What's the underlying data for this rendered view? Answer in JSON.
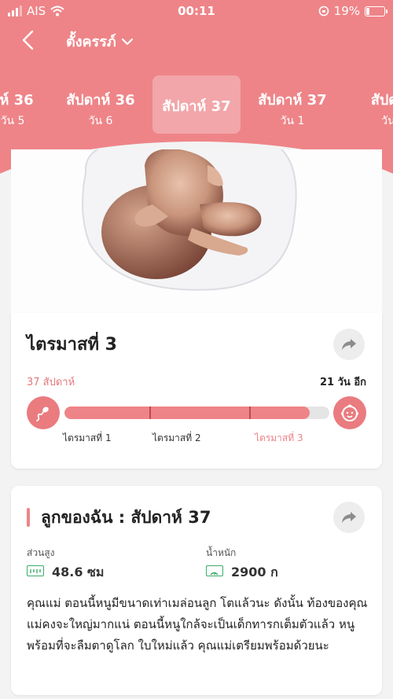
{
  "status_bar": {
    "carrier": "AIS",
    "time": "00:11",
    "battery": "19%",
    "battery_level": 0.19
  },
  "nav": {
    "title": "ตั้งครรภ์"
  },
  "tabs": [
    {
      "line1": "าห์ 36",
      "line2": "วัน 5"
    },
    {
      "line1": "สัปดาห์ 36",
      "line2": "วัน 6"
    },
    {
      "line1": "สัปดาห์ 37",
      "line2": ""
    },
    {
      "line1": "สัปดาห์ 37",
      "line2": "วัน 1"
    },
    {
      "line1": "สัปดา",
      "line2": "วัน"
    }
  ],
  "trimester": {
    "title": "ไตรมาสที่ 3",
    "weeks": "37 สัปดาห์",
    "days_left": "21 วัน อีก",
    "progress": 0.925,
    "labels": [
      "ไตรมาสที่ 1",
      "ไตรมาสที่ 2",
      "ไตรมาสที่ 3"
    ]
  },
  "baby": {
    "title": "ลูกของฉัน :  สัปดาห์ 37",
    "height_label": "ส่วนสูง",
    "height_value": "48.6 ซม",
    "weight_label": "น้ำหนัก",
    "weight_value": "2900 ก",
    "description": "คุณแม่ ตอนนี้หนูมีขนาดเท่าเมล่อนลูก โตแล้วนะ ดังนั้น ท้องของคุณแม่คงจะใหญ่มากแน่ ตอนนี้หนูใกล้จะเป็นเด็กทารกเต็มตัวแล้ว หนูพร้อมที่จะลืมตาดูโลก ใบใหม่แล้ว คุณแม่เตรียมพร้อมด้วยนะ"
  },
  "colors": {
    "primary": "#ee8488",
    "accent_green": "#3cac6a",
    "background": "#f3f3f3"
  },
  "icons": [
    "wifi-icon",
    "back-chevron-icon",
    "chevron-down-icon",
    "share-icon",
    "sperm-icon",
    "baby-face-icon",
    "ruler-icon",
    "scale-icon"
  ]
}
